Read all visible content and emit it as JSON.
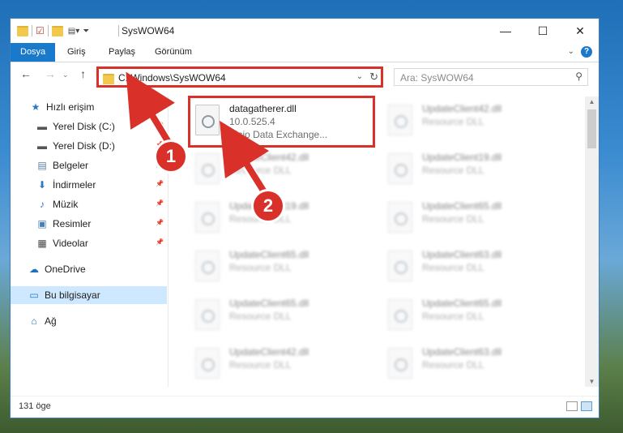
{
  "window": {
    "title": "SysWOW64",
    "controls": {
      "minimize": "—",
      "maximize": "☐",
      "close": "✕"
    }
  },
  "ribbon": {
    "tabs": [
      {
        "label": "Dosya",
        "active": true
      },
      {
        "label": "Giriş"
      },
      {
        "label": "Paylaş"
      },
      {
        "label": "Görünüm"
      }
    ]
  },
  "nav": {
    "back": "←",
    "forward": "→",
    "up": "↑"
  },
  "address": {
    "path": "C:\\Windows\\SysWOW64"
  },
  "search": {
    "placeholder": "Ara: SysWOW64"
  },
  "sidebar": {
    "items": [
      {
        "label": "Hızlı erişim",
        "icon": "star-icon",
        "glyph": "★",
        "color": "#2b78c5"
      },
      {
        "label": "Yerel Disk (C:)",
        "icon": "drive-icon",
        "glyph": "▬",
        "color": "#555"
      },
      {
        "label": "Yerel Disk (D:)",
        "icon": "drive-icon",
        "glyph": "▬",
        "color": "#555"
      },
      {
        "label": "Belgeler",
        "icon": "documents-icon",
        "glyph": "▤",
        "color": "#5a7ea8"
      },
      {
        "label": "İndirmeler",
        "icon": "download-icon",
        "glyph": "⬇",
        "color": "#2b78c5"
      },
      {
        "label": "Müzik",
        "icon": "music-icon",
        "glyph": "♪",
        "color": "#2b78c5"
      },
      {
        "label": "Resimler",
        "icon": "pictures-icon",
        "glyph": "▣",
        "color": "#4a7fb5"
      },
      {
        "label": "Videolar",
        "icon": "videos-icon",
        "glyph": "▦",
        "color": "#444"
      },
      {
        "label": "OneDrive",
        "icon": "cloud-icon",
        "glyph": "☁",
        "color": "#1f6fbf"
      },
      {
        "label": "Bu bilgisayar",
        "icon": "computer-icon",
        "glyph": "▭",
        "color": "#2b78c5"
      },
      {
        "label": "Ağ",
        "icon": "network-icon",
        "glyph": "⌂",
        "color": "#2b78c5"
      }
    ]
  },
  "files": {
    "highlight": {
      "name": "datagatherer.dll",
      "version": "10.0.525.4",
      "description": "Visio Data Exchange..."
    },
    "blurred": [
      {
        "name": "UpdateClient42.dll",
        "type": "Resource DLL"
      },
      {
        "name": "UpdateClient42.dll",
        "type": "Resource DLL"
      },
      {
        "name": "UpdateClient19.dll",
        "type": "Resource DLL"
      },
      {
        "name": "UpdateClient19.dll",
        "type": "Resource DLL"
      },
      {
        "name": "UpdateClient65.dll",
        "type": "Resource DLL"
      },
      {
        "name": "UpdateClient65.dll",
        "type": "Resource DLL"
      },
      {
        "name": "UpdateClient63.dll",
        "type": "Resource DLL"
      },
      {
        "name": "UpdateClient65.dll",
        "type": "Resource DLL"
      },
      {
        "name": "UpdateClient65.dll",
        "type": "Resource DLL"
      },
      {
        "name": "UpdateClient42.dll",
        "type": "Resource DLL"
      },
      {
        "name": "UpdateClient63.dll",
        "type": "Resource DLL"
      }
    ]
  },
  "status": {
    "count": "131 öge"
  },
  "annotations": {
    "badge1": "1",
    "badge2": "2",
    "color": "#d9312a"
  }
}
